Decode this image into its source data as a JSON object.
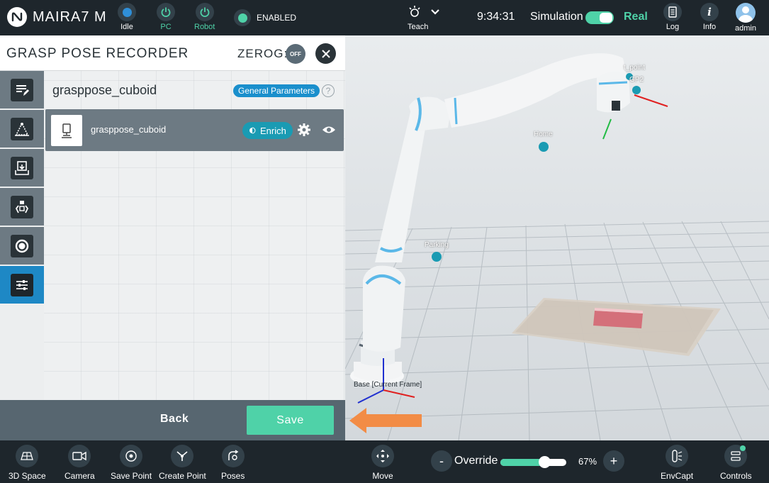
{
  "topbar": {
    "brand": "MAIRA7 M",
    "logo_icon": "n-logo-icon",
    "status": [
      {
        "label": "Idle",
        "icon": "status-dot-icon",
        "teal": false
      },
      {
        "label": "PC",
        "icon": "power-icon",
        "teal": true
      },
      {
        "label": "Robot",
        "icon": "power-icon",
        "teal": true
      }
    ],
    "enabled_label": "ENABLED",
    "teach_label": "Teach",
    "clock": "9:34:31",
    "simulation_label": "Simulation",
    "real_label": "Real",
    "log_label": "Log",
    "info_label": "Info",
    "user_label": "admin"
  },
  "panel": {
    "title": "GRASP POSE RECORDER",
    "zerog_label": "ZEROG:",
    "zerog_state": "OFF",
    "content_title": "grasppose_cuboid",
    "general_params_label": "General Parameters",
    "help_glyph": "?",
    "item": {
      "name": "grasppose_cuboid",
      "enrich_label": "Enrich"
    },
    "back_label": "Back",
    "save_label": "Save",
    "side_tabs": [
      {
        "icon": "edit-list-icon",
        "active": false
      },
      {
        "icon": "pose-frame-icon",
        "active": false
      },
      {
        "icon": "download-tray-icon",
        "active": false
      },
      {
        "icon": "gripper-icon",
        "active": false
      },
      {
        "icon": "record-icon",
        "active": false
      },
      {
        "icon": "sliders-icon",
        "active": true
      }
    ]
  },
  "viewport": {
    "labels": {
      "home": "Home",
      "parking": "Parking",
      "gp2": "GP2",
      "point": "t_point",
      "base": "Base [Current Frame]"
    }
  },
  "bottombar": {
    "items": [
      {
        "label": "3D Space",
        "icon": "3d-space-icon"
      },
      {
        "label": "Camera",
        "icon": "camera-icon"
      },
      {
        "label": "Save Point",
        "icon": "save-point-icon"
      },
      {
        "label": "Create Point",
        "icon": "create-point-icon"
      },
      {
        "label": "Poses",
        "icon": "poses-icon"
      }
    ],
    "move_label": "Move",
    "override_label": "Override",
    "override_value": 67,
    "override_text": "67%",
    "minus_glyph": "-",
    "plus_glyph": "+",
    "envcapt_label": "EnvCapt",
    "controls_label": "Controls"
  },
  "colors": {
    "accent": "#4fd2a8",
    "blue": "#1e88c5",
    "topbar_bg": "#1e262c",
    "arrow": "#f28c46"
  }
}
